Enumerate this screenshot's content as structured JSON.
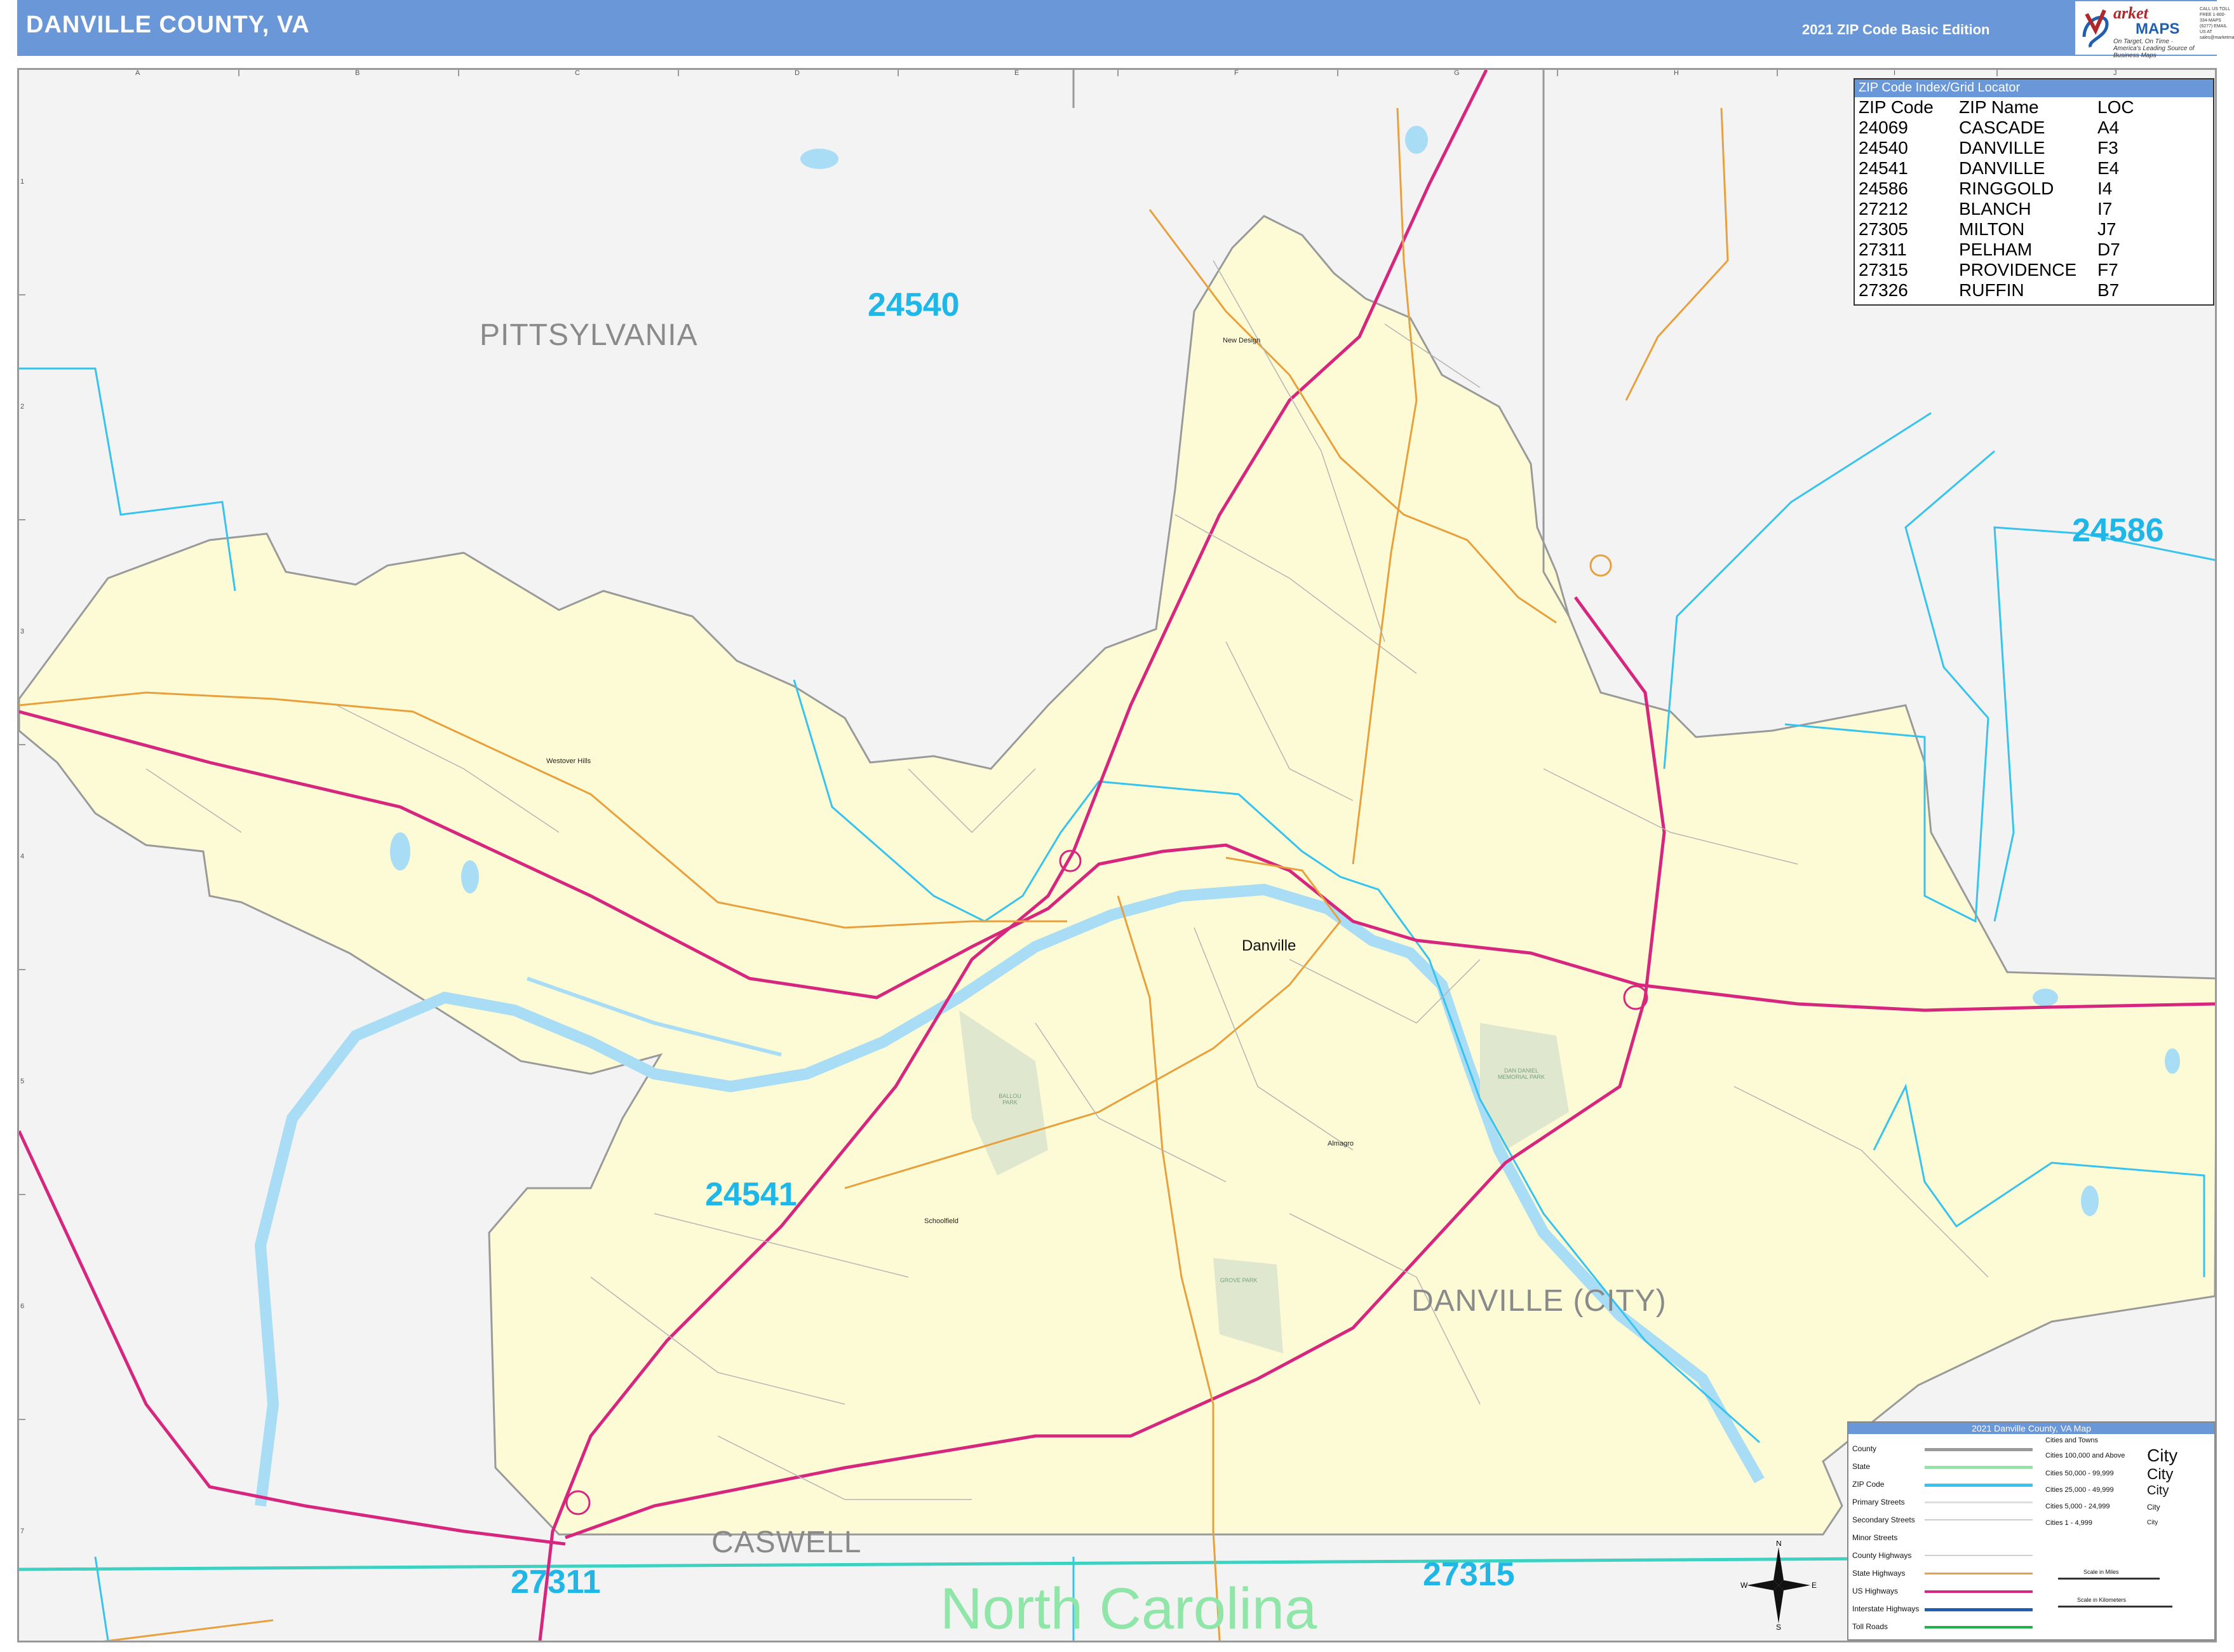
{
  "header": {
    "title": "DANVILLE COUNTY, VA",
    "edition": "2021 ZIP Code Basic Edition"
  },
  "logo": {
    "name_top": "arket",
    "name_bottom": "MAPS",
    "tagline": "On Target, On Time · America's Leading Source of Business Maps",
    "contact": "CALL US TOLL FREE 1-800-334-MAPS (6277) EMAIL US AT sales@marketmaps.com"
  },
  "grid": {
    "columns": [
      "A",
      "B",
      "C",
      "D",
      "E",
      "F",
      "G",
      "H",
      "I",
      "J"
    ],
    "rows": [
      "1",
      "2",
      "3",
      "4",
      "5",
      "6",
      "7"
    ]
  },
  "zip_labels": [
    {
      "code": "24540"
    },
    {
      "code": "24586"
    },
    {
      "code": "24541"
    },
    {
      "code": "27311"
    },
    {
      "code": "27315"
    }
  ],
  "region_labels": {
    "pittsylvania": "PITTSYLVANIA",
    "danville_city": "DANVILLE (CITY)",
    "caswell": "CASWELL",
    "north_carolina": "North Carolina"
  },
  "places": {
    "danville": "Danville",
    "new_design": "New Design",
    "westover_hills": "Westover Hills",
    "almagro": "Almagro",
    "schoolfield": "Schoolfield",
    "ballou_park": "BALLOU PARK",
    "dan_daniel_park": "DAN DANIEL MEMORIAL PARK",
    "grove_park": "GROVE PARK"
  },
  "zip_index": {
    "title": "ZIP Code Index/Grid Locator",
    "headers": [
      "ZIP Code",
      "ZIP Name",
      "LOC"
    ],
    "rows": [
      [
        "24069",
        "CASCADE",
        "A4"
      ],
      [
        "24540",
        "DANVILLE",
        "F3"
      ],
      [
        "24541",
        "DANVILLE",
        "E4"
      ],
      [
        "24586",
        "RINGGOLD",
        "I4"
      ],
      [
        "27212",
        "BLANCH",
        "I7"
      ],
      [
        "27305",
        "MILTON",
        "J7"
      ],
      [
        "27311",
        "PELHAM",
        "D7"
      ],
      [
        "27315",
        "PROVIDENCE",
        "F7"
      ],
      [
        "27326",
        "RUFFIN",
        "B7"
      ]
    ]
  },
  "legend": {
    "title": "2021 Danville County, VA Map",
    "items": [
      "County",
      "State",
      "ZIP Code",
      "Primary Streets",
      "Secondary Streets",
      "Minor Streets",
      "County Highways",
      "State Highways",
      "US Highways",
      "Interstate Highways",
      "Toll Roads"
    ],
    "cities_title": "Cities and Towns",
    "city_classes": [
      {
        "range": "Cities 100,000 and Above",
        "label": "City"
      },
      {
        "range": "Cities 50,000 - 99,999",
        "label": "City"
      },
      {
        "range": "Cities 25,000 - 49,999",
        "label": "City"
      },
      {
        "range": "Cities 5,000 - 24,999",
        "label": "City"
      },
      {
        "range": "Cities 1 - 4,999",
        "label": "City"
      }
    ],
    "scale_miles": "Scale in Miles",
    "scale_km": "Scale in Kilometers"
  },
  "compass": {
    "n": "N",
    "s": "S",
    "e": "E",
    "w": "W"
  },
  "colors": {
    "header": "#6a97d8",
    "zip_text": "#1fb6e8",
    "zip_boundary": "#36c3ee",
    "county_fill": "#fdfbd6",
    "outside_fill": "#f3f3f4",
    "water": "#a9dcf5",
    "us_highway": "#d6267e",
    "state_highway": "#e8a03c",
    "state_boundary": "#3cd1c0",
    "park": "#dfe8cf"
  }
}
